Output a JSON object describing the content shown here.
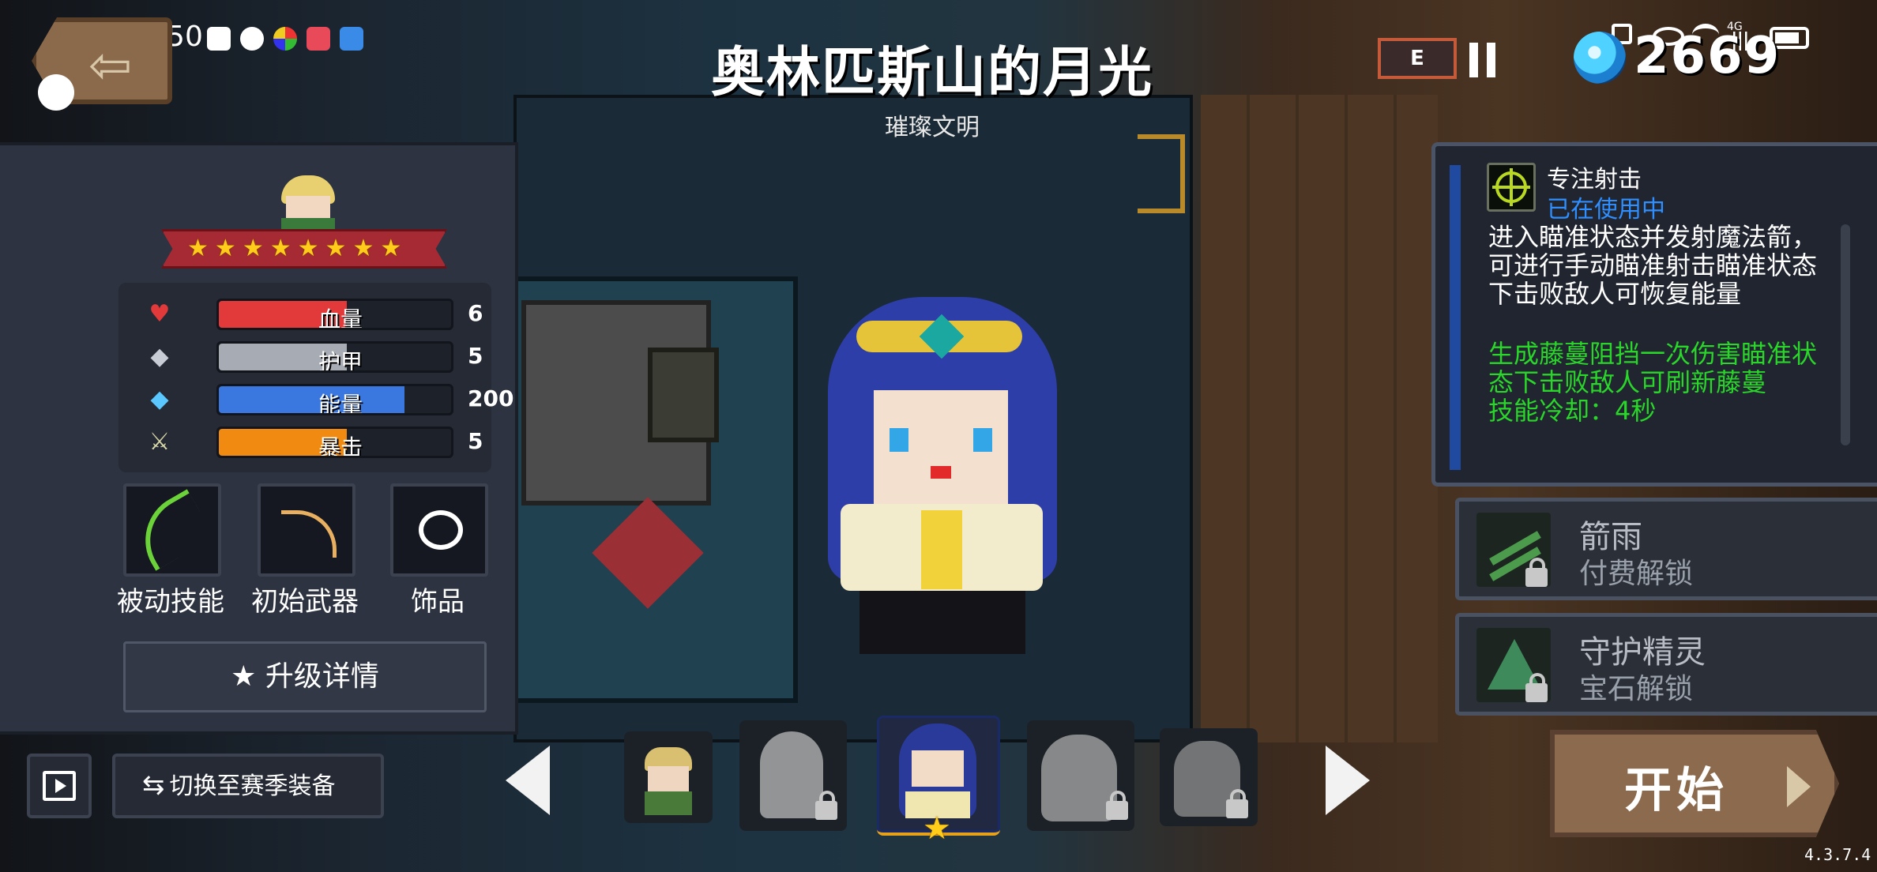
{
  "status_bar": {
    "time": "9:50",
    "net": "4G"
  },
  "header": {
    "title": "奥林匹斯山的月光",
    "subtitle": "璀璨文明",
    "gem_count": "2669",
    "eco_badge": "E"
  },
  "stats": [
    {
      "label": "血量",
      "value": "6",
      "fill": 0.55,
      "color": "#e23a3a"
    },
    {
      "label": "护甲",
      "value": "5",
      "fill": 0.55,
      "color": "#a7acb4"
    },
    {
      "label": "能量",
      "value": "200",
      "fill": 0.8,
      "color": "#3a78e0"
    },
    {
      "label": "暴击",
      "value": "5",
      "fill": 0.55,
      "color": "#f08a10"
    }
  ],
  "hero_stars": 8,
  "slots": {
    "passive": "被动技能",
    "weapon": "初始武器",
    "accessory": "饰品"
  },
  "upgrade_button": "★ 升级详情",
  "season_button": "切换至赛季装备",
  "skill": {
    "name": "专注射击",
    "status": "已在使用中",
    "description": "进入瞄准状态并发射魔法箭，可进行手动瞄准射击瞄准状态下击败敌人可恢复能量",
    "extra": "生成藤蔓阻挡一次伤害瞄准状态下击败敌人可刷新藤蔓",
    "cooldown": "技能冷却：4秒"
  },
  "alt_skills": [
    {
      "name": "箭雨",
      "unlock": "付费解锁"
    },
    {
      "name": "守护精灵",
      "unlock": "宝石解锁"
    }
  ],
  "start_button": "开始",
  "version": "4.3.7.4",
  "colors": {
    "accent_blue": "#2f8fff",
    "skill_green": "#29d629",
    "banner_red": "#a62a33",
    "start_brown": "#8b6a4d"
  }
}
